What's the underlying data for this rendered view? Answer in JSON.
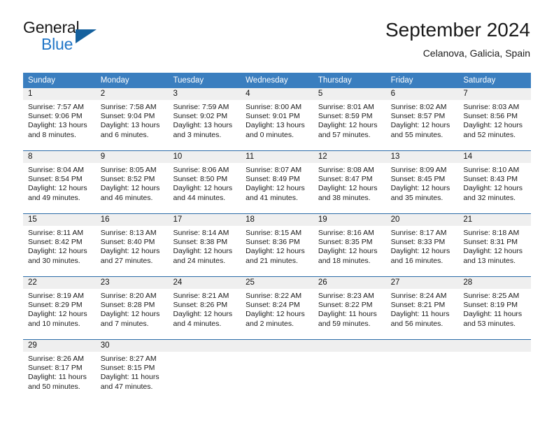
{
  "logo": {
    "word_one": "General",
    "word_two": "Blue",
    "flag_icon": "triangle-flag-icon",
    "brand_blue": "#2176c7",
    "flag_blue": "#15619e"
  },
  "header": {
    "title": "September 2024",
    "location": "Celanova, Galicia, Spain"
  },
  "calendar": {
    "header_bg": "#3a7ebf",
    "daynum_bg": "#efefef",
    "row_divider": "#2b6ca8",
    "weekdays": [
      "Sunday",
      "Monday",
      "Tuesday",
      "Wednesday",
      "Thursday",
      "Friday",
      "Saturday"
    ],
    "weeks": [
      [
        {
          "day": "1",
          "sunrise": "Sunrise: 7:57 AM",
          "sunset": "Sunset: 9:06 PM",
          "daylight_1": "Daylight: 13 hours",
          "daylight_2": "and 8 minutes."
        },
        {
          "day": "2",
          "sunrise": "Sunrise: 7:58 AM",
          "sunset": "Sunset: 9:04 PM",
          "daylight_1": "Daylight: 13 hours",
          "daylight_2": "and 6 minutes."
        },
        {
          "day": "3",
          "sunrise": "Sunrise: 7:59 AM",
          "sunset": "Sunset: 9:02 PM",
          "daylight_1": "Daylight: 13 hours",
          "daylight_2": "and 3 minutes."
        },
        {
          "day": "4",
          "sunrise": "Sunrise: 8:00 AM",
          "sunset": "Sunset: 9:01 PM",
          "daylight_1": "Daylight: 13 hours",
          "daylight_2": "and 0 minutes."
        },
        {
          "day": "5",
          "sunrise": "Sunrise: 8:01 AM",
          "sunset": "Sunset: 8:59 PM",
          "daylight_1": "Daylight: 12 hours",
          "daylight_2": "and 57 minutes."
        },
        {
          "day": "6",
          "sunrise": "Sunrise: 8:02 AM",
          "sunset": "Sunset: 8:57 PM",
          "daylight_1": "Daylight: 12 hours",
          "daylight_2": "and 55 minutes."
        },
        {
          "day": "7",
          "sunrise": "Sunrise: 8:03 AM",
          "sunset": "Sunset: 8:56 PM",
          "daylight_1": "Daylight: 12 hours",
          "daylight_2": "and 52 minutes."
        }
      ],
      [
        {
          "day": "8",
          "sunrise": "Sunrise: 8:04 AM",
          "sunset": "Sunset: 8:54 PM",
          "daylight_1": "Daylight: 12 hours",
          "daylight_2": "and 49 minutes."
        },
        {
          "day": "9",
          "sunrise": "Sunrise: 8:05 AM",
          "sunset": "Sunset: 8:52 PM",
          "daylight_1": "Daylight: 12 hours",
          "daylight_2": "and 46 minutes."
        },
        {
          "day": "10",
          "sunrise": "Sunrise: 8:06 AM",
          "sunset": "Sunset: 8:50 PM",
          "daylight_1": "Daylight: 12 hours",
          "daylight_2": "and 44 minutes."
        },
        {
          "day": "11",
          "sunrise": "Sunrise: 8:07 AM",
          "sunset": "Sunset: 8:49 PM",
          "daylight_1": "Daylight: 12 hours",
          "daylight_2": "and 41 minutes."
        },
        {
          "day": "12",
          "sunrise": "Sunrise: 8:08 AM",
          "sunset": "Sunset: 8:47 PM",
          "daylight_1": "Daylight: 12 hours",
          "daylight_2": "and 38 minutes."
        },
        {
          "day": "13",
          "sunrise": "Sunrise: 8:09 AM",
          "sunset": "Sunset: 8:45 PM",
          "daylight_1": "Daylight: 12 hours",
          "daylight_2": "and 35 minutes."
        },
        {
          "day": "14",
          "sunrise": "Sunrise: 8:10 AM",
          "sunset": "Sunset: 8:43 PM",
          "daylight_1": "Daylight: 12 hours",
          "daylight_2": "and 32 minutes."
        }
      ],
      [
        {
          "day": "15",
          "sunrise": "Sunrise: 8:11 AM",
          "sunset": "Sunset: 8:42 PM",
          "daylight_1": "Daylight: 12 hours",
          "daylight_2": "and 30 minutes."
        },
        {
          "day": "16",
          "sunrise": "Sunrise: 8:13 AM",
          "sunset": "Sunset: 8:40 PM",
          "daylight_1": "Daylight: 12 hours",
          "daylight_2": "and 27 minutes."
        },
        {
          "day": "17",
          "sunrise": "Sunrise: 8:14 AM",
          "sunset": "Sunset: 8:38 PM",
          "daylight_1": "Daylight: 12 hours",
          "daylight_2": "and 24 minutes."
        },
        {
          "day": "18",
          "sunrise": "Sunrise: 8:15 AM",
          "sunset": "Sunset: 8:36 PM",
          "daylight_1": "Daylight: 12 hours",
          "daylight_2": "and 21 minutes."
        },
        {
          "day": "19",
          "sunrise": "Sunrise: 8:16 AM",
          "sunset": "Sunset: 8:35 PM",
          "daylight_1": "Daylight: 12 hours",
          "daylight_2": "and 18 minutes."
        },
        {
          "day": "20",
          "sunrise": "Sunrise: 8:17 AM",
          "sunset": "Sunset: 8:33 PM",
          "daylight_1": "Daylight: 12 hours",
          "daylight_2": "and 16 minutes."
        },
        {
          "day": "21",
          "sunrise": "Sunrise: 8:18 AM",
          "sunset": "Sunset: 8:31 PM",
          "daylight_1": "Daylight: 12 hours",
          "daylight_2": "and 13 minutes."
        }
      ],
      [
        {
          "day": "22",
          "sunrise": "Sunrise: 8:19 AM",
          "sunset": "Sunset: 8:29 PM",
          "daylight_1": "Daylight: 12 hours",
          "daylight_2": "and 10 minutes."
        },
        {
          "day": "23",
          "sunrise": "Sunrise: 8:20 AM",
          "sunset": "Sunset: 8:28 PM",
          "daylight_1": "Daylight: 12 hours",
          "daylight_2": "and 7 minutes."
        },
        {
          "day": "24",
          "sunrise": "Sunrise: 8:21 AM",
          "sunset": "Sunset: 8:26 PM",
          "daylight_1": "Daylight: 12 hours",
          "daylight_2": "and 4 minutes."
        },
        {
          "day": "25",
          "sunrise": "Sunrise: 8:22 AM",
          "sunset": "Sunset: 8:24 PM",
          "daylight_1": "Daylight: 12 hours",
          "daylight_2": "and 2 minutes."
        },
        {
          "day": "26",
          "sunrise": "Sunrise: 8:23 AM",
          "sunset": "Sunset: 8:22 PM",
          "daylight_1": "Daylight: 11 hours",
          "daylight_2": "and 59 minutes."
        },
        {
          "day": "27",
          "sunrise": "Sunrise: 8:24 AM",
          "sunset": "Sunset: 8:21 PM",
          "daylight_1": "Daylight: 11 hours",
          "daylight_2": "and 56 minutes."
        },
        {
          "day": "28",
          "sunrise": "Sunrise: 8:25 AM",
          "sunset": "Sunset: 8:19 PM",
          "daylight_1": "Daylight: 11 hours",
          "daylight_2": "and 53 minutes."
        }
      ],
      [
        {
          "day": "29",
          "sunrise": "Sunrise: 8:26 AM",
          "sunset": "Sunset: 8:17 PM",
          "daylight_1": "Daylight: 11 hours",
          "daylight_2": "and 50 minutes."
        },
        {
          "day": "30",
          "sunrise": "Sunrise: 8:27 AM",
          "sunset": "Sunset: 8:15 PM",
          "daylight_1": "Daylight: 11 hours",
          "daylight_2": "and 47 minutes."
        },
        {
          "day": "",
          "sunrise": "",
          "sunset": "",
          "daylight_1": "",
          "daylight_2": ""
        },
        {
          "day": "",
          "sunrise": "",
          "sunset": "",
          "daylight_1": "",
          "daylight_2": ""
        },
        {
          "day": "",
          "sunrise": "",
          "sunset": "",
          "daylight_1": "",
          "daylight_2": ""
        },
        {
          "day": "",
          "sunrise": "",
          "sunset": "",
          "daylight_1": "",
          "daylight_2": ""
        },
        {
          "day": "",
          "sunrise": "",
          "sunset": "",
          "daylight_1": "",
          "daylight_2": ""
        }
      ]
    ]
  }
}
